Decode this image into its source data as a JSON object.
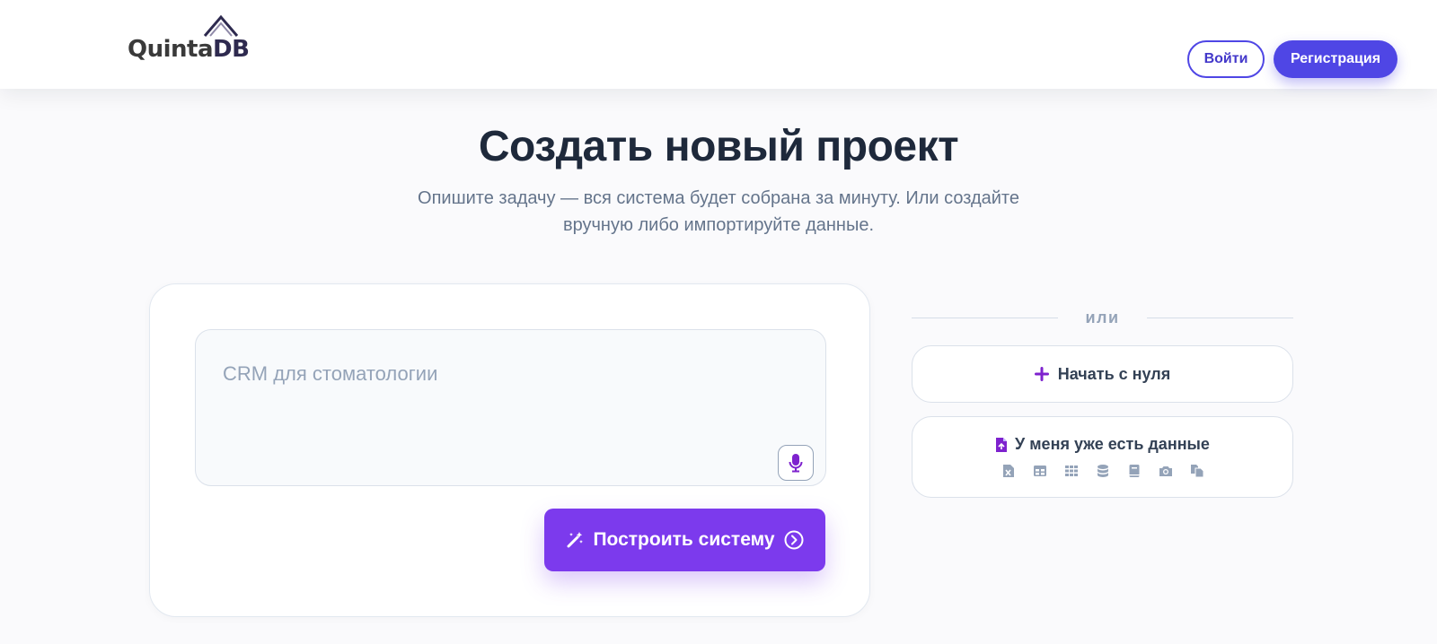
{
  "header": {
    "logo": {
      "text_main": "Quinta",
      "text_accent": "DB"
    },
    "login_label": "Войти",
    "register_label": "Регистрация"
  },
  "hero": {
    "title": "Создать новый проект",
    "subtitle": "Опишите задачу — вся система будет собрана за минуту. Или создайте вручную либо импортируйте данные."
  },
  "builder": {
    "prompt_placeholder": "CRM для стоматологии",
    "prompt_value": "",
    "mic_icon": "microphone-icon",
    "build_icon": "magic-wand-icon",
    "build_label": "Построить систему",
    "build_arrow_icon": "chevron-circle-right-icon"
  },
  "alternatives": {
    "or_label": "или",
    "start_scratch": {
      "icon": "plus-icon",
      "label": "Начать с нуля"
    },
    "have_data": {
      "icon": "file-upload-icon",
      "label": "У меня уже есть данные",
      "sources": [
        "excel-file-icon",
        "table-icon",
        "grid-icon",
        "database-icon",
        "book-icon",
        "camera-icon",
        "copy-files-icon"
      ]
    }
  },
  "colors": {
    "brand": "#4f46e5",
    "build_button": "#7c3aed",
    "accent_icon": "#7e22ce",
    "muted_text": "#64748b",
    "source_icons": "#94a3b8"
  }
}
